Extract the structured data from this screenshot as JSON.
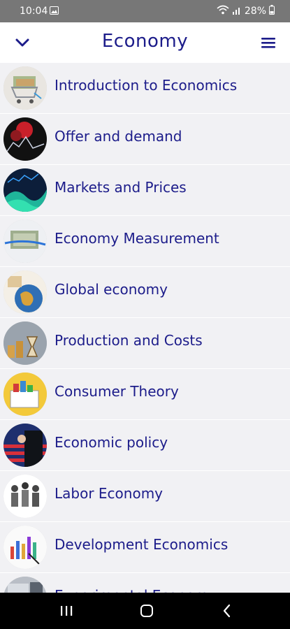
{
  "status_bar": {
    "time": "10:04",
    "battery": "28%",
    "icons": [
      "gallery-icon",
      "wifi-icon",
      "signal-icon",
      "battery-icon"
    ]
  },
  "app_bar": {
    "title": "Economy",
    "back_icon": "chevron-down-icon",
    "menu_icon": "hamburger-menu-icon"
  },
  "topics": [
    {
      "label": "Introduction to Economics",
      "thumb": "shopping-cart-money"
    },
    {
      "label": "Offer and demand",
      "thumb": "red-chart-dark"
    },
    {
      "label": "Markets and Prices",
      "thumb": "stock-wave"
    },
    {
      "label": "Economy Measurement",
      "thumb": "banknotes-tape"
    },
    {
      "label": "Global economy",
      "thumb": "globe"
    },
    {
      "label": "Production and Costs",
      "thumb": "coins-hourglass"
    },
    {
      "label": "Consumer Theory",
      "thumb": "shopping-basket"
    },
    {
      "label": "Economic policy",
      "thumb": "flag-podium"
    },
    {
      "label": "Labor Economy",
      "thumb": "workers"
    },
    {
      "label": "Development Economics",
      "thumb": "bar-chart-paper"
    },
    {
      "label": "Experimental Economy",
      "thumb": "desk"
    }
  ],
  "nav_bar": {
    "icons": [
      "recent-apps-icon",
      "home-icon",
      "back-icon"
    ]
  },
  "colors": {
    "accent": "#1c1c8a",
    "row_background": "#f1f1f4",
    "status_bar": "#777777",
    "nav_bar": "#000000"
  }
}
